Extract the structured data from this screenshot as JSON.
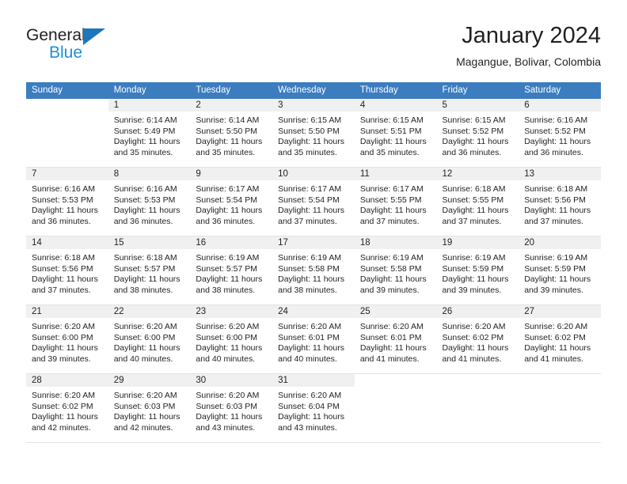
{
  "brand": {
    "name_part1": "General",
    "name_part2": "Blue",
    "triangle_color": "#1b76bc",
    "blue_text_color": "#1b8ede"
  },
  "header": {
    "title": "January 2024",
    "subtitle": "Magangue, Bolivar, Colombia"
  },
  "calendar": {
    "header_bg": "#3b7dbf",
    "daynum_bg": "#f0f0f0",
    "weekdays": [
      "Sunday",
      "Monday",
      "Tuesday",
      "Wednesday",
      "Thursday",
      "Friday",
      "Saturday"
    ],
    "weeks": [
      [
        {
          "day": "",
          "blank": true
        },
        {
          "day": "1",
          "sunrise": "Sunrise: 6:14 AM",
          "sunset": "Sunset: 5:49 PM",
          "daylight": "Daylight: 11 hours and 35 minutes."
        },
        {
          "day": "2",
          "sunrise": "Sunrise: 6:14 AM",
          "sunset": "Sunset: 5:50 PM",
          "daylight": "Daylight: 11 hours and 35 minutes."
        },
        {
          "day": "3",
          "sunrise": "Sunrise: 6:15 AM",
          "sunset": "Sunset: 5:50 PM",
          "daylight": "Daylight: 11 hours and 35 minutes."
        },
        {
          "day": "4",
          "sunrise": "Sunrise: 6:15 AM",
          "sunset": "Sunset: 5:51 PM",
          "daylight": "Daylight: 11 hours and 35 minutes."
        },
        {
          "day": "5",
          "sunrise": "Sunrise: 6:15 AM",
          "sunset": "Sunset: 5:52 PM",
          "daylight": "Daylight: 11 hours and 36 minutes."
        },
        {
          "day": "6",
          "sunrise": "Sunrise: 6:16 AM",
          "sunset": "Sunset: 5:52 PM",
          "daylight": "Daylight: 11 hours and 36 minutes."
        }
      ],
      [
        {
          "day": "7",
          "sunrise": "Sunrise: 6:16 AM",
          "sunset": "Sunset: 5:53 PM",
          "daylight": "Daylight: 11 hours and 36 minutes."
        },
        {
          "day": "8",
          "sunrise": "Sunrise: 6:16 AM",
          "sunset": "Sunset: 5:53 PM",
          "daylight": "Daylight: 11 hours and 36 minutes."
        },
        {
          "day": "9",
          "sunrise": "Sunrise: 6:17 AM",
          "sunset": "Sunset: 5:54 PM",
          "daylight": "Daylight: 11 hours and 36 minutes."
        },
        {
          "day": "10",
          "sunrise": "Sunrise: 6:17 AM",
          "sunset": "Sunset: 5:54 PM",
          "daylight": "Daylight: 11 hours and 37 minutes."
        },
        {
          "day": "11",
          "sunrise": "Sunrise: 6:17 AM",
          "sunset": "Sunset: 5:55 PM",
          "daylight": "Daylight: 11 hours and 37 minutes."
        },
        {
          "day": "12",
          "sunrise": "Sunrise: 6:18 AM",
          "sunset": "Sunset: 5:55 PM",
          "daylight": "Daylight: 11 hours and 37 minutes."
        },
        {
          "day": "13",
          "sunrise": "Sunrise: 6:18 AM",
          "sunset": "Sunset: 5:56 PM",
          "daylight": "Daylight: 11 hours and 37 minutes."
        }
      ],
      [
        {
          "day": "14",
          "sunrise": "Sunrise: 6:18 AM",
          "sunset": "Sunset: 5:56 PM",
          "daylight": "Daylight: 11 hours and 37 minutes."
        },
        {
          "day": "15",
          "sunrise": "Sunrise: 6:18 AM",
          "sunset": "Sunset: 5:57 PM",
          "daylight": "Daylight: 11 hours and 38 minutes."
        },
        {
          "day": "16",
          "sunrise": "Sunrise: 6:19 AM",
          "sunset": "Sunset: 5:57 PM",
          "daylight": "Daylight: 11 hours and 38 minutes."
        },
        {
          "day": "17",
          "sunrise": "Sunrise: 6:19 AM",
          "sunset": "Sunset: 5:58 PM",
          "daylight": "Daylight: 11 hours and 38 minutes."
        },
        {
          "day": "18",
          "sunrise": "Sunrise: 6:19 AM",
          "sunset": "Sunset: 5:58 PM",
          "daylight": "Daylight: 11 hours and 39 minutes."
        },
        {
          "day": "19",
          "sunrise": "Sunrise: 6:19 AM",
          "sunset": "Sunset: 5:59 PM",
          "daylight": "Daylight: 11 hours and 39 minutes."
        },
        {
          "day": "20",
          "sunrise": "Sunrise: 6:19 AM",
          "sunset": "Sunset: 5:59 PM",
          "daylight": "Daylight: 11 hours and 39 minutes."
        }
      ],
      [
        {
          "day": "21",
          "sunrise": "Sunrise: 6:20 AM",
          "sunset": "Sunset: 6:00 PM",
          "daylight": "Daylight: 11 hours and 39 minutes."
        },
        {
          "day": "22",
          "sunrise": "Sunrise: 6:20 AM",
          "sunset": "Sunset: 6:00 PM",
          "daylight": "Daylight: 11 hours and 40 minutes."
        },
        {
          "day": "23",
          "sunrise": "Sunrise: 6:20 AM",
          "sunset": "Sunset: 6:00 PM",
          "daylight": "Daylight: 11 hours and 40 minutes."
        },
        {
          "day": "24",
          "sunrise": "Sunrise: 6:20 AM",
          "sunset": "Sunset: 6:01 PM",
          "daylight": "Daylight: 11 hours and 40 minutes."
        },
        {
          "day": "25",
          "sunrise": "Sunrise: 6:20 AM",
          "sunset": "Sunset: 6:01 PM",
          "daylight": "Daylight: 11 hours and 41 minutes."
        },
        {
          "day": "26",
          "sunrise": "Sunrise: 6:20 AM",
          "sunset": "Sunset: 6:02 PM",
          "daylight": "Daylight: 11 hours and 41 minutes."
        },
        {
          "day": "27",
          "sunrise": "Sunrise: 6:20 AM",
          "sunset": "Sunset: 6:02 PM",
          "daylight": "Daylight: 11 hours and 41 minutes."
        }
      ],
      [
        {
          "day": "28",
          "sunrise": "Sunrise: 6:20 AM",
          "sunset": "Sunset: 6:02 PM",
          "daylight": "Daylight: 11 hours and 42 minutes."
        },
        {
          "day": "29",
          "sunrise": "Sunrise: 6:20 AM",
          "sunset": "Sunset: 6:03 PM",
          "daylight": "Daylight: 11 hours and 42 minutes."
        },
        {
          "day": "30",
          "sunrise": "Sunrise: 6:20 AM",
          "sunset": "Sunset: 6:03 PM",
          "daylight": "Daylight: 11 hours and 43 minutes."
        },
        {
          "day": "31",
          "sunrise": "Sunrise: 6:20 AM",
          "sunset": "Sunset: 6:04 PM",
          "daylight": "Daylight: 11 hours and 43 minutes."
        },
        {
          "day": "",
          "blank": true
        },
        {
          "day": "",
          "blank": true
        },
        {
          "day": "",
          "blank": true
        }
      ]
    ]
  }
}
